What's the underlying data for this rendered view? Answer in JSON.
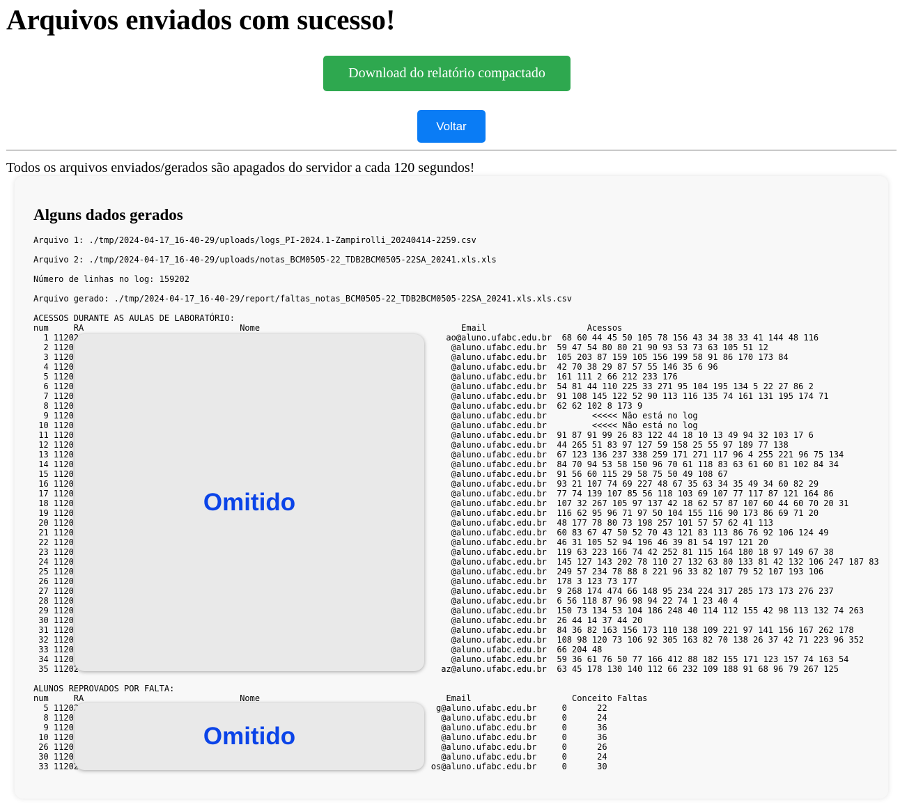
{
  "header": {
    "title": "Arquivos enviados com sucesso!",
    "download_label": "Download do relatório compactado",
    "back_label": "Voltar",
    "notice": "Todos os arquivos enviados/gerados são apagados do servidor a cada 120 segundos!"
  },
  "panel": {
    "heading": "Alguns dados gerados",
    "info_lines": [
      "Arquivo 1: ./tmp/2024-04-17_16-40-29/uploads/logs_PI-2024.1-Zampirolli_20240414-2259.csv",
      "Arquivo 2: ./tmp/2024-04-17_16-40-29/uploads/notas_BCM0505-22_TDB2BCM0505-22SA_20241.xls.xls",
      "Número de linhas no log: 159202",
      "Arquivo gerado: ./tmp/2024-04-17_16-40-29/report/faltas_notas_BCM0505-22_TDB2BCM0505-22SA_20241.xls.xls.csv"
    ],
    "access_table_text": "ACESSOS DURANTE AS AULAS DE LABORATÓRIO:\nnum     RA                               Nome                                        Email                    Acessos\n  1 11202                                                                         ao@aluno.ufabc.edu.br  68 60 44 45 50 105 78 156 43 34 38 33 41 144 48 116\n  2 1120                                                                           @aluno.ufabc.edu.br  59 47 54 80 80 21 90 93 53 73 63 105 51 12\n  3 1120                                                                           @aluno.ufabc.edu.br  105 203 87 159 105 156 199 58 91 86 170 173 84\n  4 1120                                                                           @aluno.ufabc.edu.br  42 70 38 29 87 57 55 146 35 6 96\n  5 1120                                                                           @aluno.ufabc.edu.br  161 111 2 66 212 233 176\n  6 1120                                                                           @aluno.ufabc.edu.br  54 81 44 110 225 33 271 95 104 195 134 5 22 27 86 2\n  7 1120                                                                           @aluno.ufabc.edu.br  91 108 145 122 52 90 113 116 135 74 161 131 195 174 71\n  8 1120                                                                           @aluno.ufabc.edu.br  62 62 102 8 173 9\n  9 1120                                                                           @aluno.ufabc.edu.br         <<<<< Não está no log\n 10 1120                                                                           @aluno.ufabc.edu.br         <<<<< Não está no log\n 11 1120                                                                           @aluno.ufabc.edu.br  91 87 91 99 26 83 122 44 18 10 13 49 94 32 103 17 6\n 12 1120                                                                           @aluno.ufabc.edu.br  44 265 51 83 97 127 59 158 25 55 97 189 77 138\n 13 1120                                                                           @aluno.ufabc.edu.br  67 123 136 237 338 259 171 271 117 96 4 255 221 96 75 134\n 14 1120                                                                           @aluno.ufabc.edu.br  84 70 94 53 58 150 96 70 61 118 83 63 61 60 81 102 84 34\n 15 1120                                                                           @aluno.ufabc.edu.br  91 56 60 115 29 58 75 50 49 108 67\n 16 1120                                                                           @aluno.ufabc.edu.br  93 21 107 74 69 227 48 67 35 63 34 35 49 34 60 82 29\n 17 1120                                                                           @aluno.ufabc.edu.br  77 74 139 107 85 56 118 103 69 107 77 117 87 121 164 86\n 18 1120                                                                           @aluno.ufabc.edu.br  107 32 267 105 97 137 42 18 62 57 87 107 60 44 60 70 20 31\n 19 1120                                                                           @aluno.ufabc.edu.br  116 62 95 96 71 97 50 104 155 116 90 173 86 69 71 20\n 20 1120                                                                           @aluno.ufabc.edu.br  48 177 78 80 73 198 257 101 57 57 62 41 113\n 21 1120                                                                           @aluno.ufabc.edu.br  60 83 67 47 50 52 70 43 121 83 113 86 76 92 106 124 49\n 22 1120                                                                           @aluno.ufabc.edu.br  46 31 105 52 94 196 46 39 81 54 197 121 20\n 23 1120                                                                           @aluno.ufabc.edu.br  119 63 223 166 74 42 252 81 115 164 180 18 97 149 67 38\n 24 1120                                                                           @aluno.ufabc.edu.br  145 127 143 202 78 110 27 132 63 80 133 81 42 132 106 247 187 83\n 25 1120                                                                           @aluno.ufabc.edu.br  249 57 234 78 88 8 221 96 33 82 107 79 52 107 193 106\n 26 1120                                                                           @aluno.ufabc.edu.br  178 3 123 73 177\n 27 1120                                                                           @aluno.ufabc.edu.br  9 268 174 474 66 148 95 234 224 317 285 173 173 276 237\n 28 1120                                                                           @aluno.ufabc.edu.br  6 56 118 87 96 98 94 22 74 1 23 40 4\n 29 1120                                                                           @aluno.ufabc.edu.br  150 73 134 53 104 186 248 40 114 112 155 42 98 113 132 74 263\n 30 1120                                                                           @aluno.ufabc.edu.br  26 44 14 37 44 20\n 31 1120                                                                           @aluno.ufabc.edu.br  84 36 82 163 156 173 110 138 109 221 97 141 156 167 262 178\n 32 1120                                                                           @aluno.ufabc.edu.br  108 98 120 73 106 92 305 163 82 70 138 26 37 42 71 223 96 352\n 33 1120                                                                           @aluno.ufabc.edu.br  66 204 48\n 34 1120                                                                           @aluno.ufabc.edu.br  59 36 61 76 50 77 166 412 88 182 155 171 123 157 74 163 54\n 35 11202                                                                        az@aluno.ufabc.edu.br  63 45 178 130 140 112 66 232 109 188 91 68 96 79 267 125",
    "fail_table_text": "ALUNOS REPROVADOS POR FALTA:\nnum     RA                               Nome                                     Email                    Conceito Faltas\n  5 11202                                                                       g@aluno.ufabc.edu.br     0      22\n  8 1120                                                                         @aluno.ufabc.edu.br     0      24\n  9 1120                                                                         @aluno.ufabc.edu.br     0      36\n 10 1120                                                                         @aluno.ufabc.edu.br     0      36\n 26 1120                                                                         @aluno.ufabc.edu.br     0      26\n 30 1120                                                                         @aluno.ufabc.edu.br     0      24\n 33 11202                                                                      os@aluno.ufabc.edu.br     0      30",
    "redaction_label": "Omitido"
  }
}
